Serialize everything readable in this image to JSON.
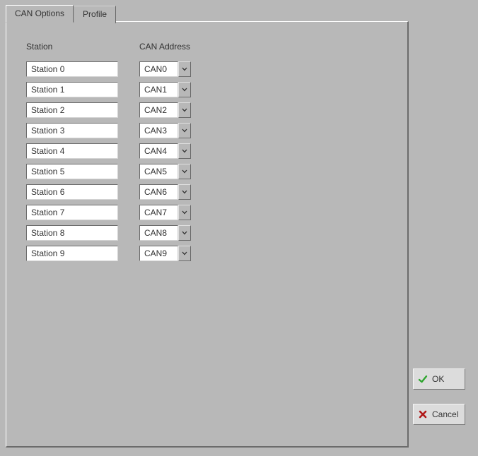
{
  "tabs": {
    "can_options": "CAN Options",
    "profile": "Profile"
  },
  "headers": {
    "station": "Station",
    "can_address": "CAN Address"
  },
  "rows": [
    {
      "station": "Station 0",
      "addr": "CAN0"
    },
    {
      "station": "Station 1",
      "addr": "CAN1"
    },
    {
      "station": "Station 2",
      "addr": "CAN2"
    },
    {
      "station": "Station 3",
      "addr": "CAN3"
    },
    {
      "station": "Station 4",
      "addr": "CAN4"
    },
    {
      "station": "Station 5",
      "addr": "CAN5"
    },
    {
      "station": "Station 6",
      "addr": "CAN6"
    },
    {
      "station": "Station 7",
      "addr": "CAN7"
    },
    {
      "station": "Station 8",
      "addr": "CAN8"
    },
    {
      "station": "Station 9",
      "addr": "CAN9"
    }
  ],
  "buttons": {
    "ok": "OK",
    "cancel": "Cancel"
  }
}
